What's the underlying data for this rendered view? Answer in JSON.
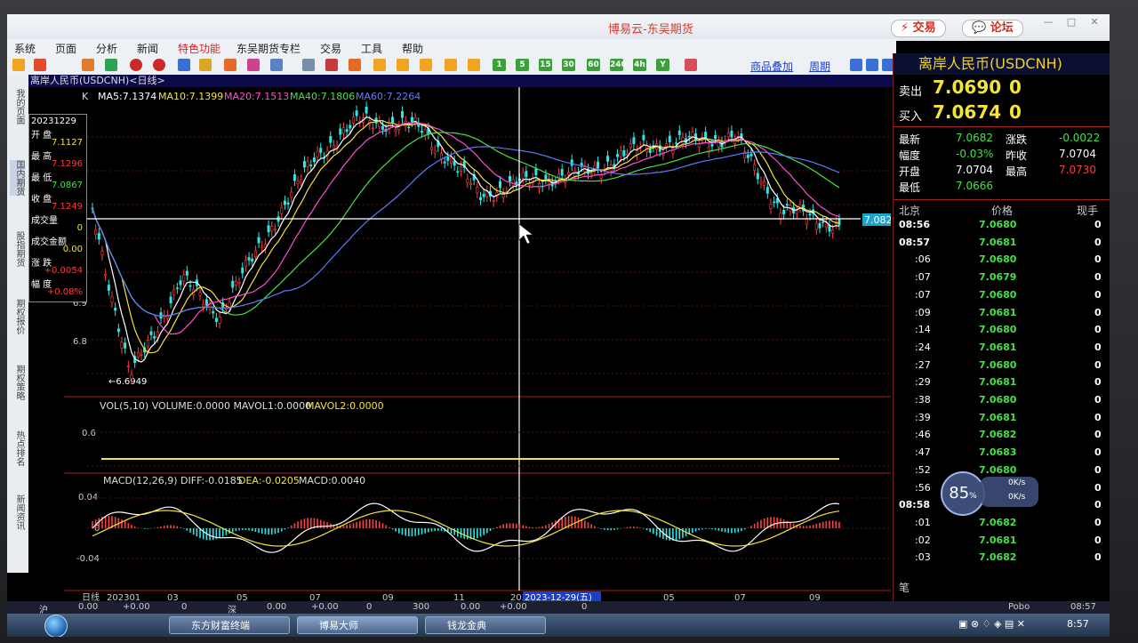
{
  "window": {
    "title": "博易云-东吴期货",
    "btn_trade": "交易",
    "btn_forum": "论坛"
  },
  "menu": [
    "系统",
    "页面",
    "分析",
    "新闻",
    "特色功能",
    "东吴期货专栏",
    "交易",
    "工具",
    "帮助"
  ],
  "toolbar": {
    "tf_labels": [
      "1",
      "5",
      "15",
      "30",
      "60",
      "240",
      "4h",
      "Y"
    ],
    "links": [
      "商品叠加",
      "周期"
    ]
  },
  "sidetabs": [
    "我的页面",
    "国内期货",
    "股指期货",
    "期权报价",
    "期权策略",
    "热点排名",
    "新闻资讯"
  ],
  "chart": {
    "title": "离岸人民币(USDCNH)<日线>",
    "ma_line": {
      "k": "K",
      "ma5": "MA5:7.1374",
      "ma10": "MA10:7.1399",
      "ma20": "MA20:7.1513",
      "ma40": "MA40:7.1806",
      "ma60": "MA60:7.2264"
    },
    "price_axis_labels": [
      "6.9",
      "6.8"
    ],
    "low_marker": "←6.6949",
    "crosshair_price": "7.0824",
    "vol_line": {
      "title": "VOL(5,10) VOLUME:0.0000 MAVOL1:0.0000",
      "mavol2": "MAVOL2:0.0000",
      "axis": "0.6"
    },
    "macd_line": {
      "title": "MACD(12,26,9) DIFF:-0.0185",
      "dea": "DEA:-0.0205",
      "macd": "MACD:0.0040",
      "axis": [
        "0.04",
        "0",
        "-0.04"
      ]
    },
    "x_axis": [
      "日线",
      "202301",
      "03",
      "05",
      "07",
      "09",
      "11",
      "202",
      "05",
      "07",
      "09"
    ],
    "crosshair_date": "2023-12-29(五)"
  },
  "infobox": {
    "date": "20231229",
    "open_label": "开  盘",
    "open": "7.1127",
    "high_label": "最  高",
    "high": "7.1296",
    "low_label": "最  低",
    "low": "7.0867",
    "close_label": "收  盘",
    "close": "7.1249",
    "vol_label": "成交量",
    "vol": "0",
    "amount_label": "成交金额",
    "amount": "0.00",
    "change_label": "涨  跌",
    "change": "+0.0054",
    "pct_label": "幅  度",
    "pct": "+0.08%"
  },
  "quote": {
    "name": "离岸人民币(USDCNH)",
    "sell_label": "卖出",
    "sell_price": "7.0690",
    "sell_vol": "0",
    "buy_label": "买入",
    "buy_price": "7.0674",
    "buy_vol": "0",
    "last_label": "最新",
    "last": "7.0682",
    "chg_label": "涨跌",
    "chg": "-0.0022",
    "range_label": "幅度",
    "range": "-0.03%",
    "prev_label": "昨收",
    "prev": "7.0704",
    "open_label": "开盘",
    "open": "7.0704",
    "high_label": "最高",
    "high": "7.0730",
    "low_label": "最低",
    "low": "7.0666",
    "col_time": "北京",
    "col_price": "价格",
    "col_vol": "现手",
    "ticks": [
      {
        "t": "08:56",
        "p": "7.0680",
        "v": "0"
      },
      {
        "t": "08:57",
        "p": "7.0681",
        "v": "0"
      },
      {
        "t": ":06",
        "p": "7.0680",
        "v": "0"
      },
      {
        "t": ":07",
        "p": "7.0679",
        "v": "0"
      },
      {
        "t": ":07",
        "p": "7.0680",
        "v": "0"
      },
      {
        "t": ":09",
        "p": "7.0681",
        "v": "0"
      },
      {
        "t": ":14",
        "p": "7.0680",
        "v": "0"
      },
      {
        "t": ":24",
        "p": "7.0681",
        "v": "0"
      },
      {
        "t": ":27",
        "p": "7.0680",
        "v": "0"
      },
      {
        "t": ":29",
        "p": "7.0681",
        "v": "0"
      },
      {
        "t": ":38",
        "p": "7.0680",
        "v": "0"
      },
      {
        "t": ":39",
        "p": "7.0681",
        "v": "0"
      },
      {
        "t": ":46",
        "p": "7.0682",
        "v": "0"
      },
      {
        "t": ":47",
        "p": "7.0683",
        "v": "0"
      },
      {
        "t": ":52",
        "p": "7.0680",
        "v": "0"
      },
      {
        "t": ":56",
        "p": "",
        "v": "0"
      },
      {
        "t": "08:58",
        "p": "",
        "v": "0"
      },
      {
        "t": ":01",
        "p": "7.0682",
        "v": "0"
      },
      {
        "t": ":02",
        "p": "7.0681",
        "v": "0"
      },
      {
        "t": ":03",
        "p": "7.0682",
        "v": "0"
      }
    ],
    "footer_label": "笔"
  },
  "gauge": {
    "percent": "85",
    "unit": "%",
    "up": "0K/s",
    "down": "0K/s"
  },
  "status": {
    "hu": "沪",
    "v1": "0.00",
    "v2": "+0.00",
    "v3": "0",
    "shen": "深",
    "v4": "0.00",
    "v5": "+0.00",
    "v6": "0",
    "v7": "0",
    "v8": "300",
    "v9": "0.00",
    "v10": "+0.00",
    "v11": "0",
    "brand": "Pobo",
    "time": "08:57"
  },
  "taskbar": {
    "apps": [
      "东方财富终端",
      "博易大师",
      "钱龙金典"
    ],
    "clock": "8:57"
  }
}
